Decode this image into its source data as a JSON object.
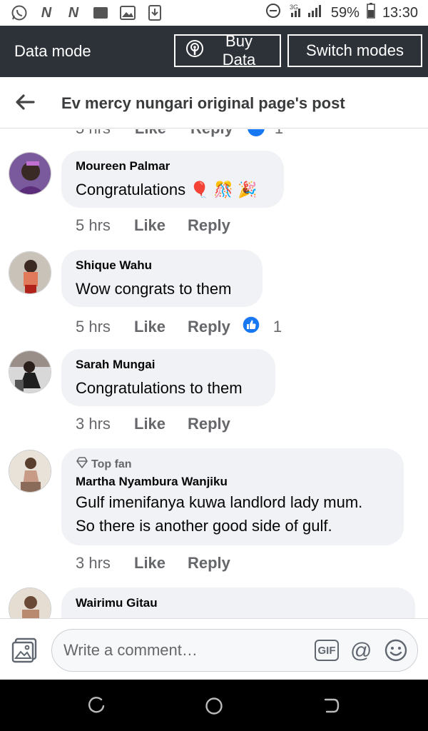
{
  "status_bar": {
    "battery": "59%",
    "time": "13:30",
    "network": "3G"
  },
  "data_mode": {
    "title": "Data mode",
    "buy_data_label": "Buy Data",
    "switch_modes_label": "Switch modes"
  },
  "header": {
    "title": "Ev mercy nungari original page's post"
  },
  "partial_row": {
    "time": "5 hrs",
    "like": "Like",
    "reply": "Reply",
    "reactions": "1"
  },
  "comments": [
    {
      "author": "Moureen Palmar",
      "top_fan": "",
      "text": "Congratulations 🎈 🎊 🎉",
      "time": "5 hrs",
      "like": "Like",
      "reply": "Reply",
      "reactions": ""
    },
    {
      "author": "Shique Wahu",
      "top_fan": "",
      "text": "Wow congrats to them",
      "time": "5 hrs",
      "like": "Like",
      "reply": "Reply",
      "reactions": "1"
    },
    {
      "author": "Sarah Mungai",
      "top_fan": "",
      "text": "Congratulations to them",
      "time": "3 hrs",
      "like": "Like",
      "reply": "Reply",
      "reactions": ""
    },
    {
      "author": "Martha Nyambura Wanjiku",
      "top_fan": "Top fan",
      "text_line1": "Gulf imenifanya kuwa landlord lady mum.",
      "text_line2": "So there is another good side of gulf.",
      "time": "3 hrs",
      "like": "Like",
      "reply": "Reply",
      "reactions": ""
    },
    {
      "author": "Wairimu Gitau"
    }
  ],
  "composer": {
    "placeholder": "Write a comment…",
    "gif_label": "GIF",
    "mention_label": "@"
  },
  "icons": {
    "back": "arrow-left-icon",
    "buy_data": "broadcast-icon",
    "photo": "photo-icon",
    "emoji": "smiley-icon",
    "like_badge": "thumbs-up-icon"
  },
  "colors": {
    "data_mode_bg": "#2d3238",
    "like_blue": "#1877f2",
    "bubble_bg": "#f0f2f5",
    "meta_gray": "#65676b"
  }
}
